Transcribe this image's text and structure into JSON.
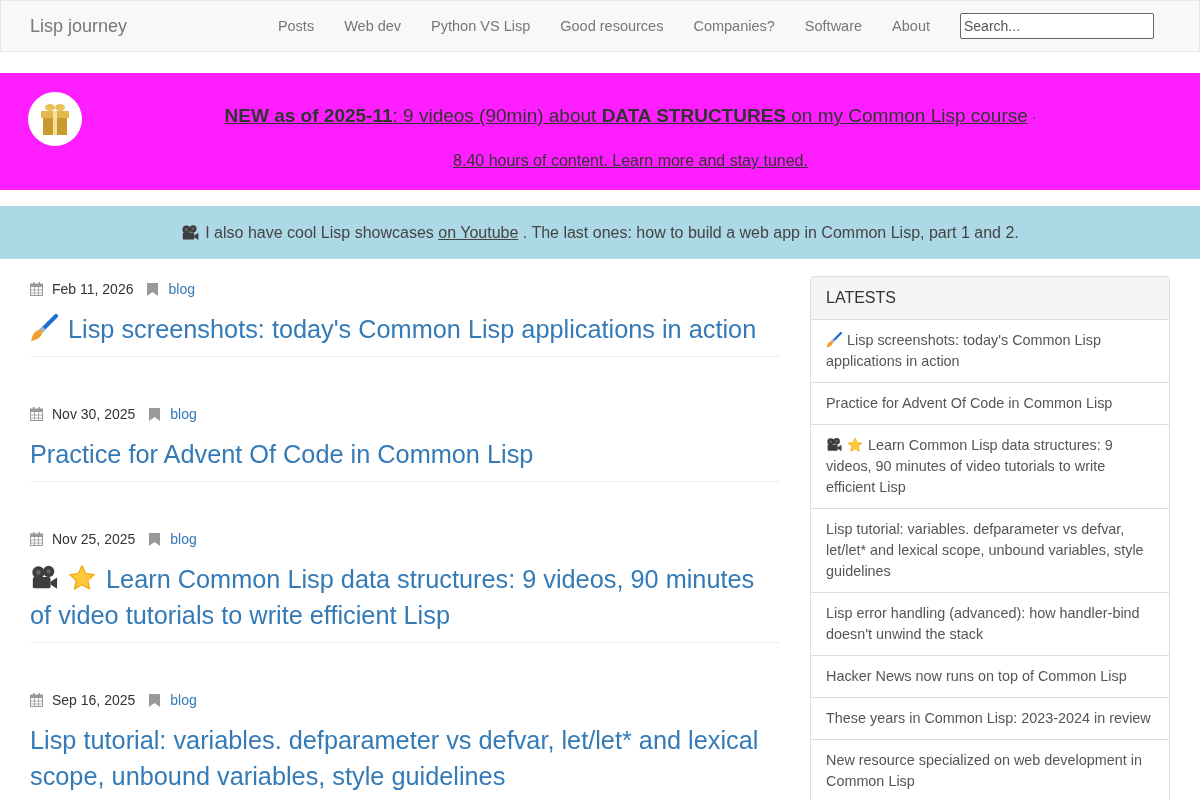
{
  "navbar": {
    "brand": "Lisp journey",
    "links": [
      "Posts",
      "Web dev",
      "Python VS Lisp",
      "Good resources",
      "Companies?",
      "Software",
      "About"
    ],
    "search": {
      "placeholder": "Search..."
    }
  },
  "announcement": {
    "link": "**NEW as of 2025-11**: 9 videos (90min) about **DATA STRUCTURES** on my Common Lisp course",
    "separator": "·",
    "secondary_link": "8.40 hours of content. Learn more and stay tuned."
  },
  "showcase": {
    "text_before": "I also have cool Lisp showcases",
    "link": "on Youtube",
    "text_after": ". The last ones: how to build a web app in Common Lisp, part 1 and 2."
  },
  "posts": [
    {
      "kind": "brush",
      "date": "Feb 11, 2026",
      "category": "blog",
      "title": "Lisp screenshots: today's Common Lisp applications in action"
    },
    {
      "kind": "text",
      "date": "Nov 30, 2025",
      "category": "blog",
      "title": "Practice for Advent Of Code in Common Lisp"
    },
    {
      "kind": "video",
      "date": "Nov 25, 2025",
      "category": "blog",
      "title": "Learn Common Lisp data structures: 9 videos, 90 minutes of video tutorials to write efficient Lisp"
    },
    {
      "kind": "text",
      "date": "Sep 16, 2025",
      "category": "blog",
      "title": "Lisp tutorial: variables. defparameter vs defvar, let/let* and lexical scope, unbound variables, style guidelines"
    }
  ],
  "sidebar": {
    "title": "LATESTS",
    "items": [
      {
        "kind": "brush",
        "title": "Lisp screenshots: today's Common Lisp applications in action"
      },
      {
        "kind": "text",
        "title": "Practice for Advent Of Code in Common Lisp"
      },
      {
        "kind": "video",
        "title": "Learn Common Lisp data structures: 9 videos, 90 minutes of video tutorials to write efficient Lisp"
      },
      {
        "kind": "text",
        "title": "Lisp tutorial: variables. defparameter vs defvar, let/let* and lexical scope, unbound variables, style guidelines"
      },
      {
        "kind": "text",
        "title": "Lisp error handling (advanced): how handler-bind doesn't unwind the stack"
      },
      {
        "kind": "text",
        "title": "Hacker News now runs on top of Common Lisp"
      },
      {
        "kind": "text",
        "title": "These years in Common Lisp: 2023-2024 in review"
      },
      {
        "kind": "text",
        "title": "New resource specialized on web development in Common Lisp"
      }
    ]
  }
}
